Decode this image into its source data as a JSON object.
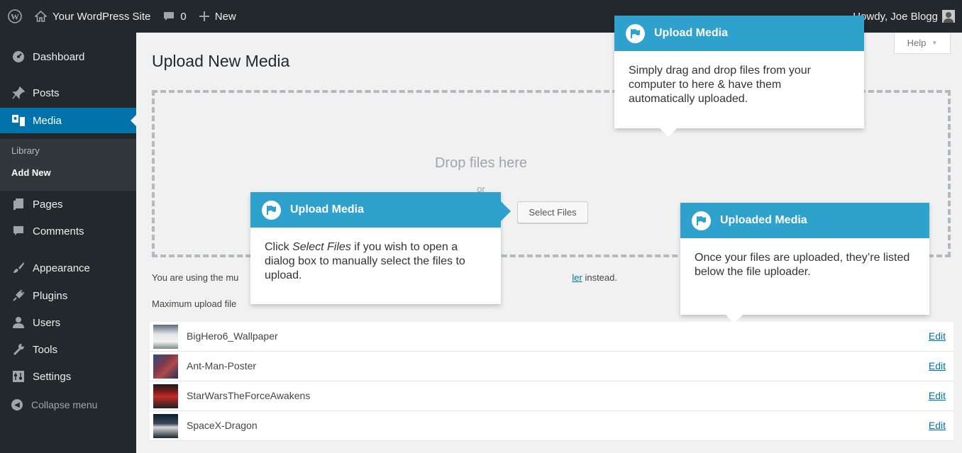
{
  "adminbar": {
    "site_name": "Your WordPress Site",
    "comment_count": "0",
    "new_label": "New",
    "howdy": "Howdy, Joe Blogg"
  },
  "sidebar": {
    "items": [
      {
        "label": "Dashboard",
        "icon": "dashboard-icon"
      },
      {
        "label": "Posts",
        "icon": "pin-icon"
      },
      {
        "label": "Media",
        "icon": "media-icon"
      },
      {
        "label": "Pages",
        "icon": "pages-icon"
      },
      {
        "label": "Comments",
        "icon": "comment-icon"
      },
      {
        "label": "Appearance",
        "icon": "brush-icon"
      },
      {
        "label": "Plugins",
        "icon": "plug-icon"
      },
      {
        "label": "Users",
        "icon": "users-icon"
      },
      {
        "label": "Tools",
        "icon": "wrench-icon"
      },
      {
        "label": "Settings",
        "icon": "settings-icon"
      }
    ],
    "submenu": [
      "Library",
      "Add New"
    ],
    "collapse_label": "Collapse menu"
  },
  "main": {
    "title": "Upload New Media",
    "help_label": "Help",
    "drop_title": "Drop files here",
    "drop_or": "or",
    "select_files": "Select Files",
    "browser_note_start": "You are using the mu",
    "browser_note_link": "ler",
    "browser_note_end": " instead.",
    "max_size": "Maximum upload file"
  },
  "media_items": [
    {
      "name": "BigHero6_Wallpaper",
      "edit": "Edit"
    },
    {
      "name": "Ant-Man-Poster",
      "edit": "Edit"
    },
    {
      "name": "StarWarsTheForceAwakens",
      "edit": "Edit"
    },
    {
      "name": "SpaceX-Dragon",
      "edit": "Edit"
    }
  ],
  "pointers": {
    "top": {
      "title": "Upload Media",
      "body": "Simply drag and drop files from your computer to here & have them automatically uploaded."
    },
    "left": {
      "title": "Upload Media",
      "body_pre": "Click ",
      "body_em": "Select Files",
      "body_post": " if you wish to open a dialog box to manually select the files to upload."
    },
    "right": {
      "title": "Uploaded Media",
      "body": "Once your files are uploaded, they’re listed below the file uploader."
    }
  },
  "colors": {
    "adminbar": "#23282d",
    "accent": "#0073aa",
    "pointer_header": "#2ea2cc"
  }
}
